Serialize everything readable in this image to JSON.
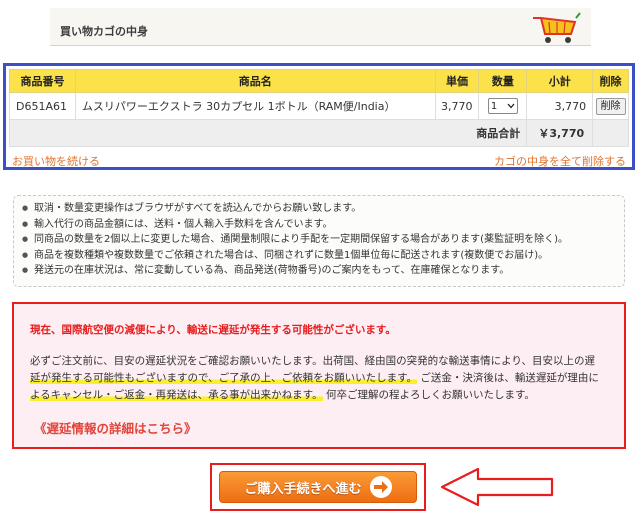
{
  "header": {
    "title": "買い物カゴの中身"
  },
  "cart": {
    "columns": [
      "商品番号",
      "商品名",
      "単価",
      "数量",
      "小計",
      "削除"
    ],
    "items": [
      {
        "code": "D651A61",
        "name": "ムスリパワーエクストラ 30カプセル 1ボトル（RAM便/India）",
        "price": "3,770",
        "qty": "1",
        "subtotal": "3,770",
        "delete_label": "削除"
      }
    ],
    "total_label": "商品合計",
    "total_value": "￥3,770",
    "continue_link": "お買い物を続ける",
    "clear_link": "カゴの中身を全て削除する"
  },
  "notes": [
    "取消・数量変更操作はブラウザがすべてを読込んでからお願い致します。",
    "輸入代行の商品金額には、送料・個人輸入手数料を含んでいます。",
    "同商品の数量を2個以上に変更した場合、通関量制限により手配を一定期間保留する場合があります(薬監証明を除く)。",
    "商品を複数種類や複数数量でご依頼された場合は、同梱されずに数量1個単位毎に配送されます(複数便でお届け)。",
    "発送元の在庫状況は、常に変動している為、商品発送(荷物番号)のご案内をもって、在庫確保となります。"
  ],
  "warning": {
    "headline": "現在、国際航空便の減便により、輸送に遅延が発生する可能性がございます。",
    "body_1": "必ずご注文前に、目安の遅延状況をご確認お願いいたします。出荷国、経由国の突発的な輸送事情により、目安以上の遅",
    "body_2a": "延が発生する可能性もございますので、ご了承の上、ご依頼をお願いいたします。",
    "body_2b": "ご送金・決済後は、輸送遅延が理由に",
    "body_3a": "よるキャンセル・ご返金・再発送は、承る事が出来かねます。",
    "body_3b": "何卒ご理解の程よろしくお願いいたします。",
    "detail_link": "《遅延情報の詳細はこちら》"
  },
  "proceed": {
    "label": "ご購入手続きへ進む"
  },
  "colors": {
    "frame_blue": "#3d4fc4",
    "header_yellow": "#fce24a",
    "accent_red": "#e81d1d",
    "link_orange": "#e0732e",
    "button_orange": "#f58223"
  }
}
